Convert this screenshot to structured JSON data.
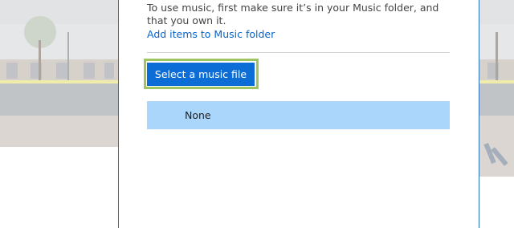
{
  "dialog": {
    "description": "To use music, first make sure it’s in your Music folder, and that you own it.",
    "link_label": "Add items to Music folder",
    "select_button_label": "Select a music file",
    "list": [
      {
        "label": "None",
        "selected": true
      }
    ]
  },
  "colors": {
    "accent": "#0d6dd6",
    "link": "#0a63c9",
    "selection": "#aad6fb",
    "focus": "#9ec55f",
    "border": "#2b6fbd"
  }
}
